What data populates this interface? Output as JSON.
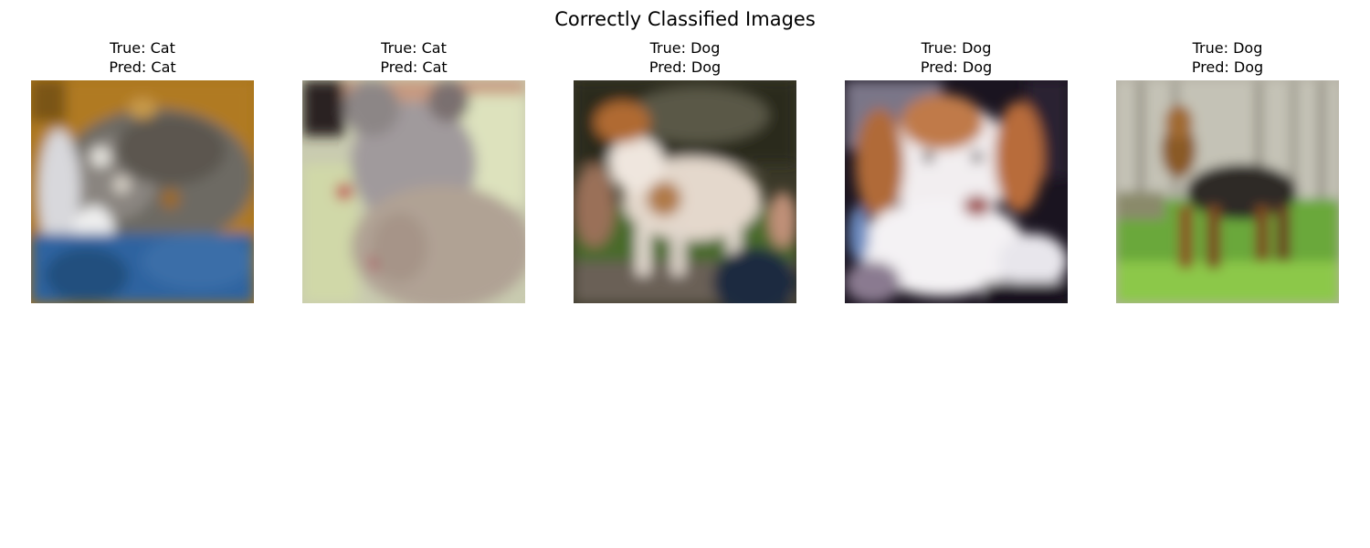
{
  "figure": {
    "title": "Correctly Classified Images"
  },
  "panels": [
    {
      "true_label": "True: Cat",
      "pred_label": "Pred: Cat",
      "subject": "gray tabby cat lying on blue fabric against orange background"
    },
    {
      "true_label": "True: Cat",
      "pred_label": "Pred: Cat",
      "subject": "light gray cat close-up with pale green background"
    },
    {
      "true_label": "True: Dog",
      "pred_label": "Pred: Dog",
      "subject": "white and brown small dog standing on grass"
    },
    {
      "true_label": "True: Dog",
      "pred_label": "Pred: Dog",
      "subject": "brown and white beagle puppy against dark background"
    },
    {
      "true_label": "True: Dog",
      "pred_label": "Pred: Dog",
      "subject": "black and tan terrier standing on green lawn near fence"
    }
  ]
}
